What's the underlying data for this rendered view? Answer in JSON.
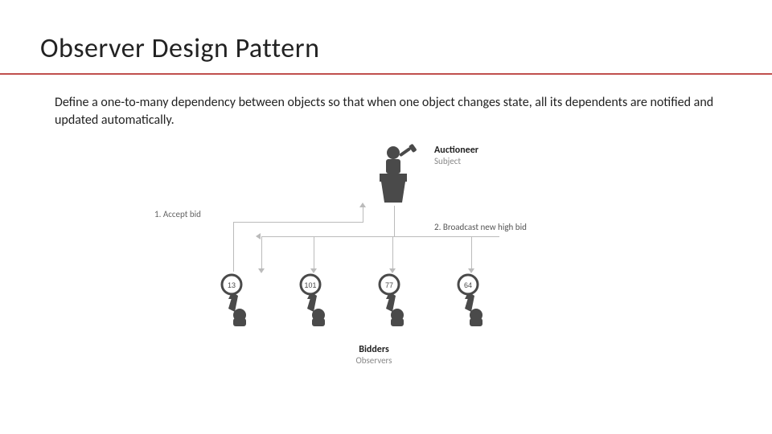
{
  "title": "Observer Design Pattern",
  "definition": "Define a one-to-many dependency between objects so that when one object changes state, all its dependents are notified and updated automatically.",
  "roles": {
    "subject_title": "Auctioneer",
    "subject_sub": "Subject",
    "observers_title": "Bidders",
    "observers_sub": "Observers"
  },
  "steps": {
    "step1": "1. Accept bid",
    "step2": "2. Broadcast new high bid"
  },
  "bidders": [
    {
      "paddle": "13"
    },
    {
      "paddle": "101"
    },
    {
      "paddle": "77"
    },
    {
      "paddle": "64"
    }
  ],
  "colors": {
    "rule": "#c0504d",
    "figure": "#4a4a4a"
  }
}
